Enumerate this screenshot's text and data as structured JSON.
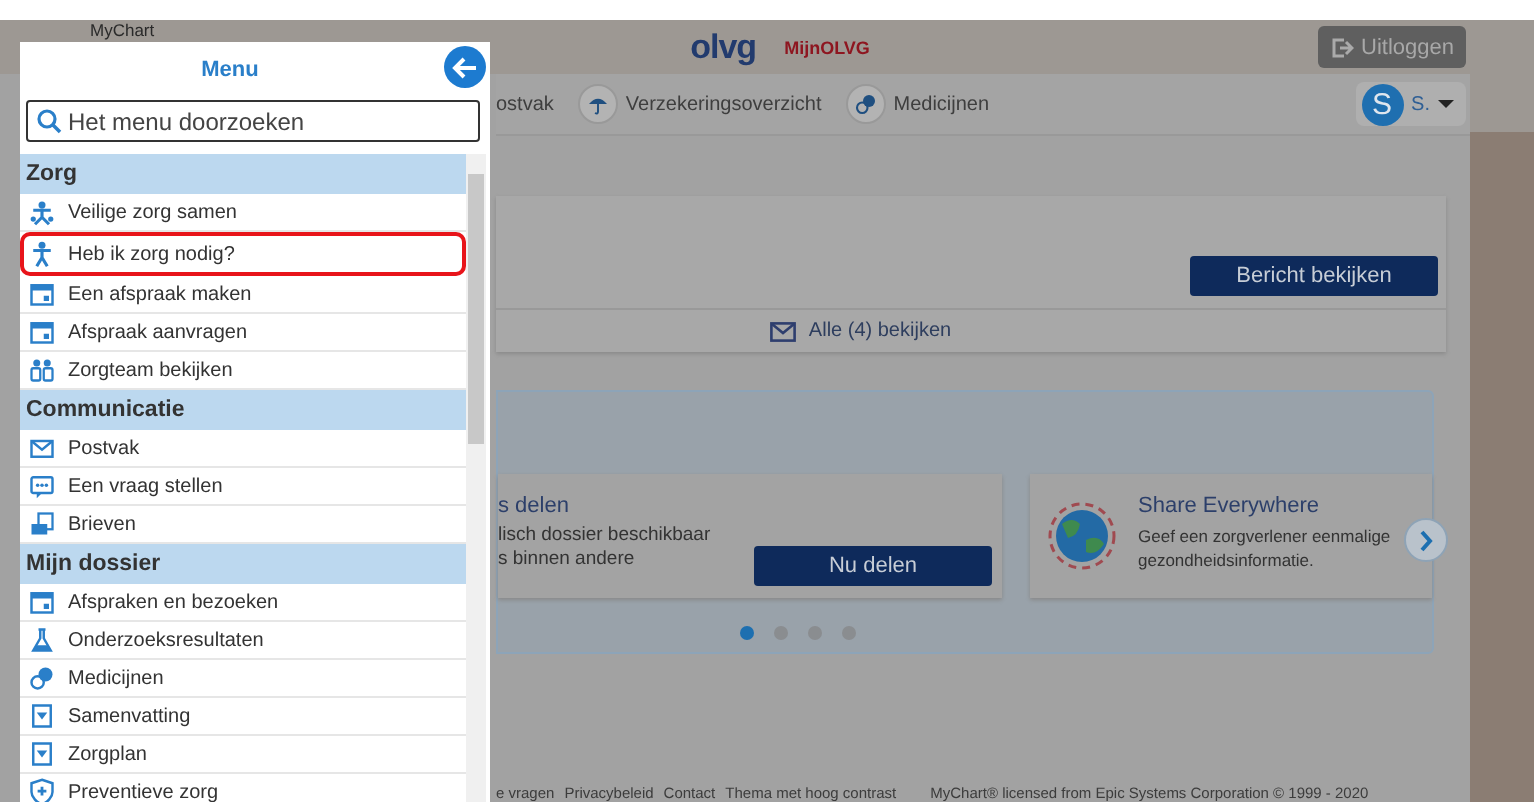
{
  "header": {
    "brand": "MyChart",
    "logo": "olvg",
    "site_name": "MijnOLVG",
    "logout_button": "Uitloggen"
  },
  "nav": {
    "items": [
      {
        "label": "ostvak"
      },
      {
        "label": "Verzekeringsoverzicht"
      },
      {
        "label": "Medicijnen"
      }
    ],
    "avatar_initial": "S",
    "user_name": "S."
  },
  "message_card": {
    "button": "Bericht bekijken",
    "view_all": "Alle (4) bekijken"
  },
  "carousel": {
    "cards": [
      {
        "title": "s delen",
        "text": "lisch dossier beschikbaar",
        "text_2": "s binnen andere",
        "button": "Nu delen"
      },
      {
        "title": "Share Everywhere",
        "text": "Geef een zorgverlener eenmalige",
        "text_2": "gezondheidsinformatie."
      }
    ],
    "dots": [
      {
        "selected": true
      },
      {
        "selected": false
      },
      {
        "selected": false
      },
      {
        "selected": false
      }
    ]
  },
  "footer": {
    "links": [
      "e vragen",
      "Privacybeleid",
      "Contact",
      "Thema met hoog contrast"
    ],
    "copyright": "MyChart® licensed from Epic Systems Corporation © 1999 - 2020"
  },
  "menu": {
    "title": "Menu",
    "search": {
      "placeholder": "Het menu doorzoeken"
    },
    "sections": [
      {
        "title": "Zorg",
        "items": [
          {
            "label": "Veilige zorg samen",
            "kind": "people",
            "highlighted": false
          },
          {
            "label": "Heb ik zorg nodig?",
            "kind": "person",
            "highlighted": true
          },
          {
            "label": "Een afspraak maken",
            "kind": "calendar",
            "highlighted": false
          },
          {
            "label": "Afspraak aanvragen",
            "kind": "calendar",
            "highlighted": false
          },
          {
            "label": "Zorgteam bekijken",
            "kind": "group",
            "highlighted": false
          }
        ]
      },
      {
        "title": "Communicatie",
        "items": [
          {
            "label": "Postvak",
            "kind": "envelope",
            "highlighted": false
          },
          {
            "label": "Een vraag stellen",
            "kind": "chat",
            "highlighted": false
          },
          {
            "label": "Brieven",
            "kind": "letter",
            "highlighted": false
          }
        ]
      },
      {
        "title": "Mijn dossier",
        "items": [
          {
            "label": "Afspraken en bezoeken",
            "kind": "calendar",
            "highlighted": false
          },
          {
            "label": "Onderzoeksresultaten",
            "kind": "flask",
            "highlighted": false
          },
          {
            "label": "Medicijnen",
            "kind": "pills",
            "highlighted": false
          },
          {
            "label": "Samenvatting",
            "kind": "document",
            "highlighted": false
          },
          {
            "label": "Zorgplan",
            "kind": "document",
            "highlighted": false
          },
          {
            "label": "Preventieve zorg",
            "kind": "shield",
            "highlighted": false
          }
        ]
      }
    ]
  }
}
